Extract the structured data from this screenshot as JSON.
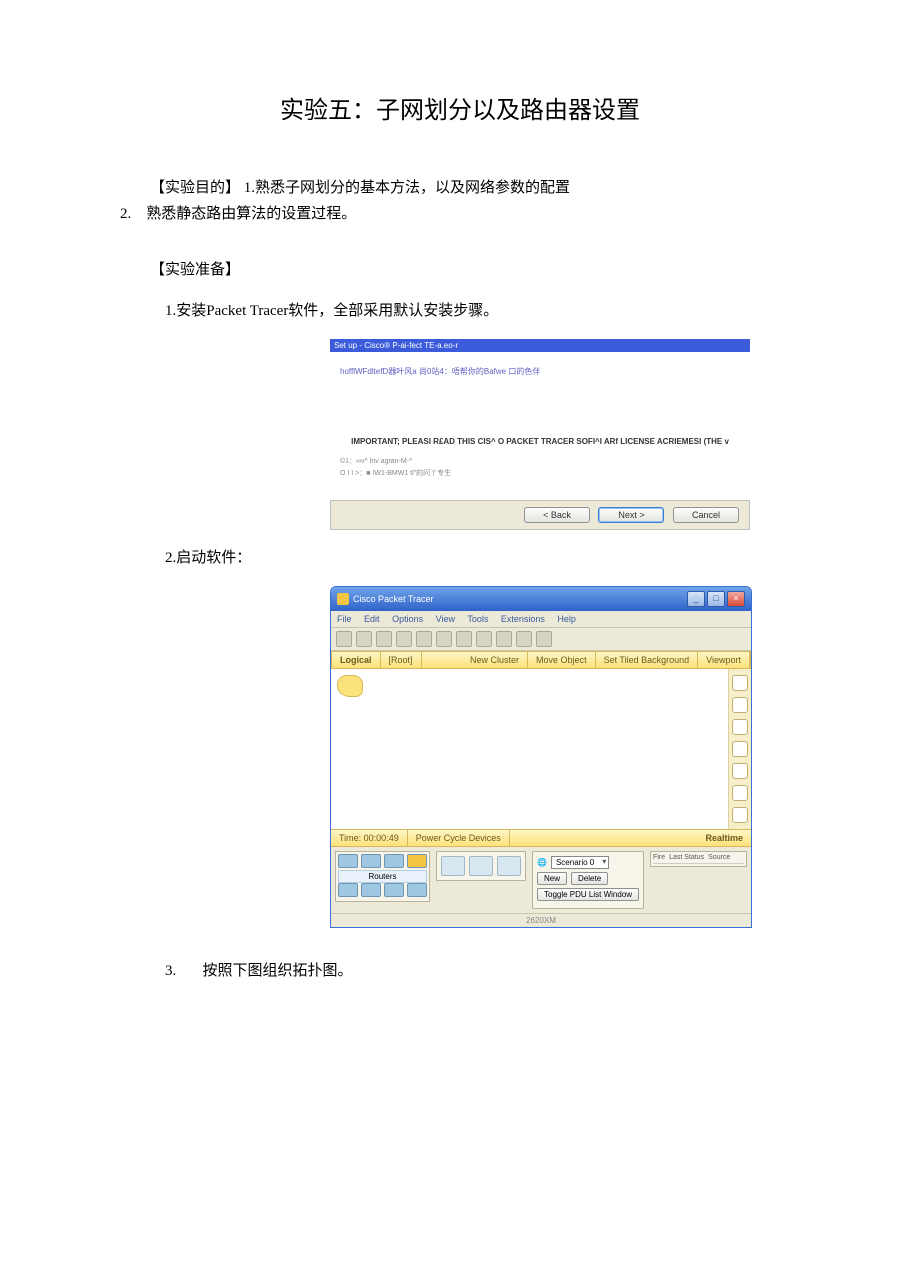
{
  "title": "实验五：子网划分以及路由器设置",
  "objective": {
    "heading": "【实验目的】",
    "item1_prefix": " 1.",
    "item1": "熟悉子网划分的基本方法，以及网络参数的配置",
    "item2_prefix": "2.",
    "item2": "熟悉静态路由算法的设置过程。"
  },
  "prep": {
    "heading": "【实验准备】",
    "step1_prefix": "1.",
    "step1": "安装Packet Tracer软件，全部采用默认安装步骤。",
    "step2_prefix": "2.",
    "step2": "启动软件：",
    "step3_prefix": "3.",
    "step3": "按照下图组织拓扑图。"
  },
  "installer": {
    "titlebar": "Set up - Cisco® P-ai-fect TE-a.eo-r",
    "headline": "hofflWFdltefD器叶风a 尚0站4：唔帮你的Bafwe 口的色伴",
    "important": "IMPORTANT; PLEASI R£AD THIS CIS^ O PACKET TRACER SOFI^I ARf LICENSE ACRIEMESI (THE v",
    "opt1": "©1：∞v^ lnv agran-M-^",
    "opt2": "O I I >：■ IW1-BMW1 tl\"的问丫专生",
    "btn_back": "< Back",
    "btn_next": "Next >",
    "btn_cancel": "Cancel"
  },
  "pt": {
    "title": "Cisco Packet Tracer",
    "menu": {
      "file": "File",
      "edit": "Edit",
      "options": "Options",
      "view": "View",
      "tools": "Tools",
      "extensions": "Extensions",
      "help": "Help"
    },
    "yellowbar": {
      "logical": "Logical",
      "root": "[Root]",
      "new_cluster": "New Cluster",
      "move": "Move Object",
      "tiled": "Set Tiled Background",
      "viewport": "Viewport"
    },
    "timebar": {
      "time": "Time: 00:00:49",
      "power": "Power Cycle Devices",
      "realtime": "Realtime"
    },
    "routers_label": "Routers",
    "scenario": {
      "icon": "globe-icon",
      "label": "Scenario 0",
      "new": "New",
      "delete": "Delete",
      "toggle": "Toggle PDU List Window"
    },
    "right": {
      "col1": "Fire",
      "col2": "Last Status",
      "col3": "Source"
    },
    "model": "2620XM"
  }
}
